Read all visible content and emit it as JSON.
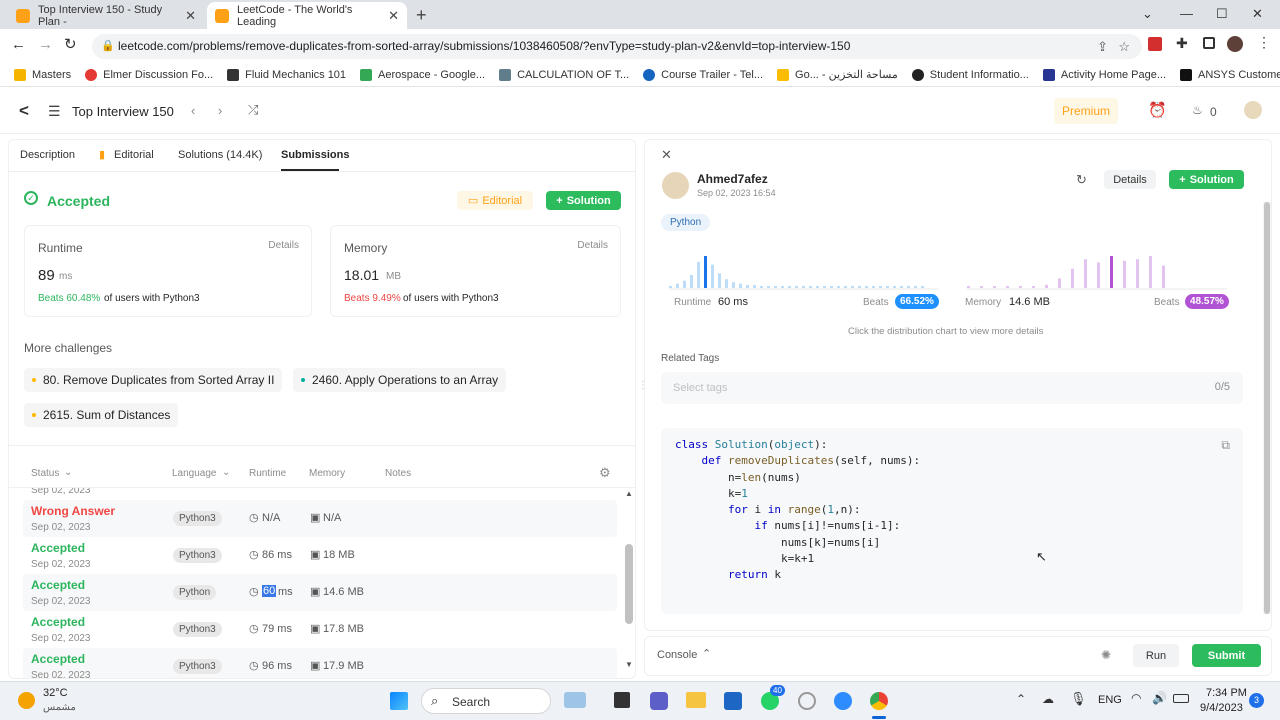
{
  "browser": {
    "tabs": [
      {
        "title": "Top Interview 150 - Study Plan -",
        "active": false
      },
      {
        "title": "LeetCode - The World's Leading",
        "active": true
      }
    ],
    "url": "leetcode.com/problems/remove-duplicates-from-sorted-array/submissions/1038460508/?envType=study-plan-v2&envId=top-interview-150",
    "bookmarks": [
      "Masters",
      "Elmer Discussion Fo...",
      "Fluid Mechanics 101",
      "Aerospace - Google...",
      "CALCULATION OF T...",
      "Course Trailer - Tel...",
      "Go... - مساحة التخزين",
      "Student Informatio...",
      "Activity Home Page...",
      "ANSYS Customer P..."
    ]
  },
  "nav": {
    "plan_title": "Top Interview 150",
    "premium": "Premium",
    "streak": "0"
  },
  "left": {
    "tabs": [
      "Description",
      "Editorial",
      "Solutions (14.4K)",
      "Submissions"
    ],
    "status": "Accepted",
    "editorial_btn": "Editorial",
    "solution_btn": "Solution",
    "runtime": {
      "label": "Runtime",
      "details": "Details",
      "value": "89",
      "unit": "ms",
      "beats": "Beats 60.48%",
      "suffix": "of users with Python3"
    },
    "memory": {
      "label": "Memory",
      "details": "Details",
      "value": "18.01",
      "unit": "MB",
      "beats": "Beats 9.49%",
      "suffix": "of users with Python3"
    },
    "more_challenges": "More challenges",
    "challenges": [
      {
        "label": "80. Remove Duplicates from Sorted Array II",
        "color": "#ffb800"
      },
      {
        "label": "2460. Apply Operations to an Array",
        "color": "#00af9b"
      },
      {
        "label": "2615. Sum of Distances",
        "color": "#ffb800"
      }
    ],
    "table_headers": [
      "Status",
      "Language",
      "Runtime",
      "Memory",
      "Notes"
    ],
    "partial_date": "Sep 02, 2023",
    "submissions": [
      {
        "status": "Wrong Answer",
        "date": "Sep 02, 2023",
        "lang": "Python3",
        "runtime": "N/A",
        "memory": "N/A",
        "color": "#ef4743"
      },
      {
        "status": "Accepted",
        "date": "Sep 02, 2023",
        "lang": "Python3",
        "runtime": "86 ms",
        "memory": "18 MB",
        "color": "#2db55d"
      },
      {
        "status": "Accepted",
        "date": "Sep 02, 2023",
        "lang": "Python",
        "runtime_hl": "60",
        "runtime_unit": "ms",
        "memory": "14.6 MB",
        "color": "#2db55d"
      },
      {
        "status": "Accepted",
        "date": "Sep 02, 2023",
        "lang": "Python3",
        "runtime": "79 ms",
        "memory": "17.8 MB",
        "color": "#2db55d"
      },
      {
        "status": "Accepted",
        "date": "Sep 02, 2023",
        "lang": "Python3",
        "runtime": "96 ms",
        "memory": "17.9 MB",
        "color": "#2db55d"
      }
    ]
  },
  "right": {
    "user": "Ahmed7afez",
    "date": "Sep 02, 2023 16:54",
    "details_btn": "Details",
    "solution_btn": "Solution",
    "language": "Python",
    "runtime_label": "Runtime",
    "runtime_value": "60 ms",
    "runtime_beats_label": "Beats",
    "runtime_beats": "66.52%",
    "memory_label": "Memory",
    "memory_value": "14.6 MB",
    "memory_beats_label": "Beats",
    "memory_beats": "48.57%",
    "hint": "Click the distribution chart to view more details",
    "related_tags": "Related Tags",
    "tags_placeholder": "Select tags",
    "tags_count": "0/5",
    "runtime_dist": [
      1,
      3,
      5,
      9,
      18,
      22,
      16,
      10,
      6,
      4,
      3,
      2,
      2,
      1,
      1,
      1,
      1,
      1,
      1,
      1,
      1,
      1,
      1,
      1,
      1,
      1,
      1,
      1,
      1,
      1,
      1,
      1,
      1,
      1,
      1,
      1,
      1
    ],
    "runtime_dist_hl": 5,
    "memory_dist": [
      1,
      1,
      1,
      1,
      1,
      1,
      2,
      6,
      12,
      18,
      16,
      20,
      17,
      18,
      20,
      14
    ],
    "memory_dist_hl": 11
  },
  "code": [
    [
      [
        "kw",
        "class "
      ],
      [
        "cl",
        "Solution"
      ],
      [
        "",
        "("
      ],
      [
        "cl",
        "object"
      ],
      [
        "",
        "):"
      ]
    ],
    [
      [
        "",
        "    "
      ],
      [
        "kw",
        "def "
      ],
      [
        "fn",
        "removeDuplicates"
      ],
      [
        "",
        "(self, nums):"
      ]
    ],
    [
      [
        "",
        "        n="
      ],
      [
        "fn",
        "len"
      ],
      [
        "",
        "(nums)"
      ]
    ],
    [
      [
        "",
        "        k="
      ],
      [
        "cl",
        "1"
      ]
    ],
    [
      [
        "",
        "        "
      ],
      [
        "kw",
        "for "
      ],
      [
        "",
        "i "
      ],
      [
        "kw",
        "in "
      ],
      [
        "fn",
        "range"
      ],
      [
        "",
        "("
      ],
      [
        "cl",
        "1"
      ],
      [
        "",
        ",n):"
      ]
    ],
    [
      [
        "",
        "            "
      ],
      [
        "kw",
        "if "
      ],
      [
        "",
        "nums[i]!=nums[i-1]:"
      ]
    ],
    [
      [
        "",
        "                nums[k]=nums[i]"
      ]
    ],
    [
      [
        "",
        "                k=k+1"
      ]
    ],
    [
      [
        "",
        "        "
      ],
      [
        "kw",
        "return "
      ],
      [
        "",
        "k"
      ]
    ]
  ],
  "console": {
    "label": "Console",
    "run": "Run",
    "submit": "Submit"
  },
  "taskbar": {
    "temp": "32°C",
    "weather": "مشمس",
    "search": "Search",
    "lang": "ENG",
    "time": "7:34 PM",
    "date": "9/4/2023",
    "badge": "40",
    "notif": "3"
  }
}
